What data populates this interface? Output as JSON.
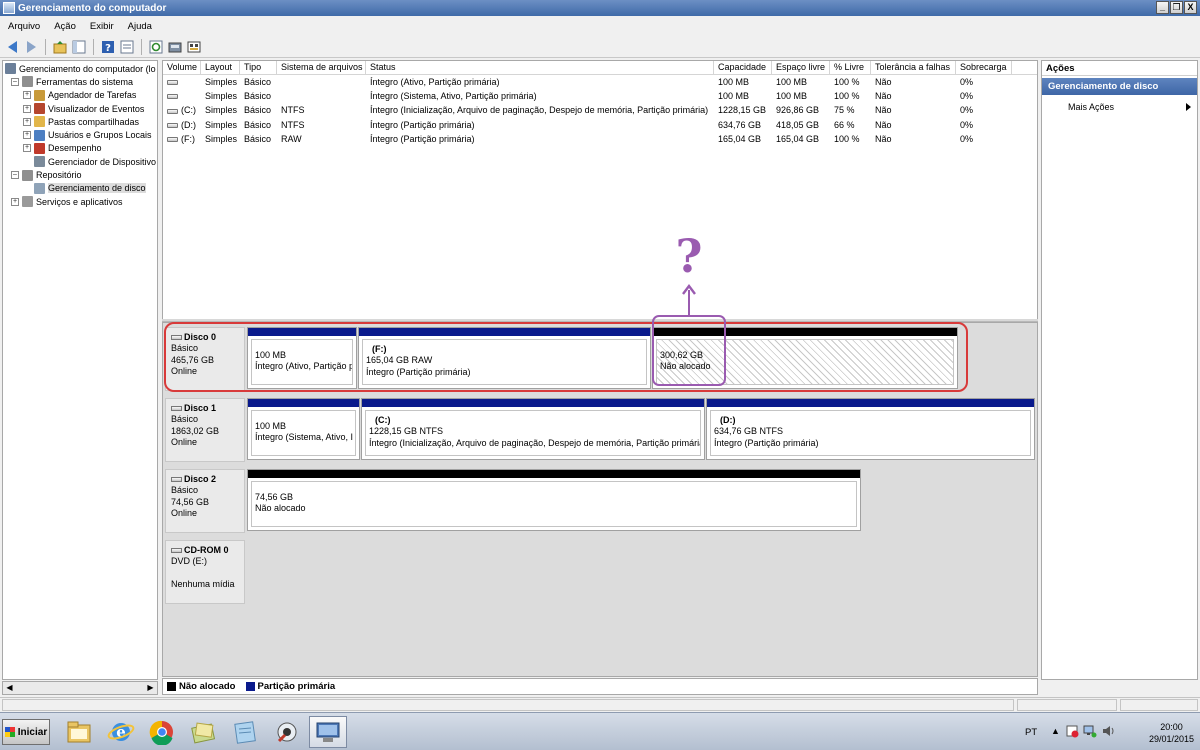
{
  "window": {
    "title": "Gerenciamento do computador",
    "buttons": [
      "_",
      "·",
      "X"
    ]
  },
  "menu": [
    "Arquivo",
    "Ação",
    "Exibir",
    "Ajuda"
  ],
  "tree": {
    "items": [
      {
        "label": "Gerenciamento do computador (lo",
        "level": 0,
        "expander": "",
        "icon": "computer-icon",
        "color": "#6b7f99"
      },
      {
        "label": "Ferramentas do sistema",
        "level": 1,
        "expander": "–",
        "icon": "tools-icon",
        "color": "#8f8f8f"
      },
      {
        "label": "Agendador de Tarefas",
        "level": 2,
        "expander": "+",
        "icon": "clock-icon",
        "color": "#c89a3a"
      },
      {
        "label": "Visualizador de Eventos",
        "level": 2,
        "expander": "+",
        "icon": "event-viewer-icon",
        "color": "#b5462e"
      },
      {
        "label": "Pastas compartilhadas",
        "level": 2,
        "expander": "+",
        "icon": "shared-folder-icon",
        "color": "#e2b64a"
      },
      {
        "label": "Usuários e Grupos Locais",
        "level": 2,
        "expander": "+",
        "icon": "users-icon",
        "color": "#4d7fc2"
      },
      {
        "label": "Desempenho",
        "level": 2,
        "expander": "+",
        "icon": "performance-icon",
        "color": "#c0392b"
      },
      {
        "label": "Gerenciador de Dispositivo",
        "level": 2,
        "expander": "",
        "icon": "device-manager-icon",
        "color": "#7a8a9a"
      },
      {
        "label": "Repositório",
        "level": 1,
        "expander": "–",
        "icon": "storage-icon",
        "color": "#8f8f8f"
      },
      {
        "label": "Gerenciamento de disco",
        "level": 2,
        "expander": "",
        "icon": "disk-management-icon",
        "color": "#8fa3b8",
        "selected": true
      },
      {
        "label": "Serviços e aplicativos",
        "level": 1,
        "expander": "+",
        "icon": "services-icon",
        "color": "#9a9a9a"
      }
    ]
  },
  "volumes": {
    "columns": [
      "Volume",
      "Layout",
      "Tipo",
      "Sistema de arquivos",
      "Status",
      "Capacidade",
      "Espaço livre",
      "% Livre",
      "Tolerância a falhas",
      "Sobrecarga"
    ],
    "rows": [
      [
        "",
        "Simples",
        "Básico",
        "",
        "Íntegro (Ativo, Partição primária)",
        "100 MB",
        "100 MB",
        "100 %",
        "Não",
        "0%"
      ],
      [
        "",
        "Simples",
        "Básico",
        "",
        "Íntegro (Sistema, Ativo, Partição primária)",
        "100 MB",
        "100 MB",
        "100 %",
        "Não",
        "0%"
      ],
      [
        "(C:)",
        "Simples",
        "Básico",
        "NTFS",
        "Íntegro (Inicialização, Arquivo de paginação, Despejo de memória, Partição primária)",
        "1228,15 GB",
        "926,86 GB",
        "75 %",
        "Não",
        "0%"
      ],
      [
        "(D:)",
        "Simples",
        "Básico",
        "NTFS",
        "Íntegro (Partição primária)",
        "634,76 GB",
        "418,05 GB",
        "66 %",
        "Não",
        "0%"
      ],
      [
        "(F:)",
        "Simples",
        "Básico",
        "RAW",
        "Íntegro (Partição primária)",
        "165,04 GB",
        "165,04 GB",
        "100 %",
        "Não",
        "0%"
      ]
    ]
  },
  "disks": [
    {
      "name": "Disco 0",
      "type": "Básico",
      "size": "465,76 GB",
      "status": "Online",
      "partitions": [
        {
          "kind": "primary",
          "label": "",
          "line1": "100 MB",
          "line2": "Íntegro (Ativo, Partição p"
        },
        {
          "kind": "primary",
          "label": "(F:)",
          "line1": "165,04 GB RAW",
          "line2": "Íntegro (Partição primária)"
        },
        {
          "kind": "unalloc",
          "label": "",
          "line1": "300,62 GB",
          "line2": "Não alocado"
        }
      ]
    },
    {
      "name": "Disco 1",
      "type": "Básico",
      "size": "1863,02 GB",
      "status": "Online",
      "partitions": [
        {
          "kind": "primary",
          "label": "",
          "line1": "100 MB",
          "line2": "Íntegro (Sistema, Ativo, I"
        },
        {
          "kind": "primary",
          "label": "(C:)",
          "line1": "1228,15 GB NTFS",
          "line2": "Íntegro (Inicialização, Arquivo de paginação, Despejo de memória, Partição primária"
        },
        {
          "kind": "primary",
          "label": "(D:)",
          "line1": "634,76 GB NTFS",
          "line2": "Íntegro (Partição primária)"
        }
      ]
    },
    {
      "name": "Disco 2",
      "type": "Básico",
      "size": "74,56 GB",
      "status": "Online",
      "partitions": [
        {
          "kind": "unalloc",
          "label": "",
          "line1": "74,56 GB",
          "line2": "Não alocado"
        }
      ]
    },
    {
      "name": "CD-ROM 0",
      "type": "DVD (E:)",
      "size": "",
      "status": "Nenhuma mídia",
      "partitions": []
    }
  ],
  "legend": [
    {
      "label": "Não alocado",
      "color": "#000000"
    },
    {
      "label": "Partição primária",
      "color": "#0a1a8c"
    }
  ],
  "annotation": {
    "text": "?",
    "color": "#9a5bb0",
    "highlight_color": "#d83a3a"
  },
  "actions": {
    "header": "Ações",
    "section": "Gerenciamento de disco",
    "items": [
      "Mais Ações"
    ]
  },
  "taskbar": {
    "start_label": "Iniciar",
    "apps": [
      "file-explorer-icon",
      "internet-explorer-icon",
      "chrome-icon",
      "folder-icon",
      "notepad-icon",
      "tool-icon",
      "computer-management-icon"
    ],
    "language": "PT",
    "time": "20:00",
    "date": "29/01/2015"
  }
}
